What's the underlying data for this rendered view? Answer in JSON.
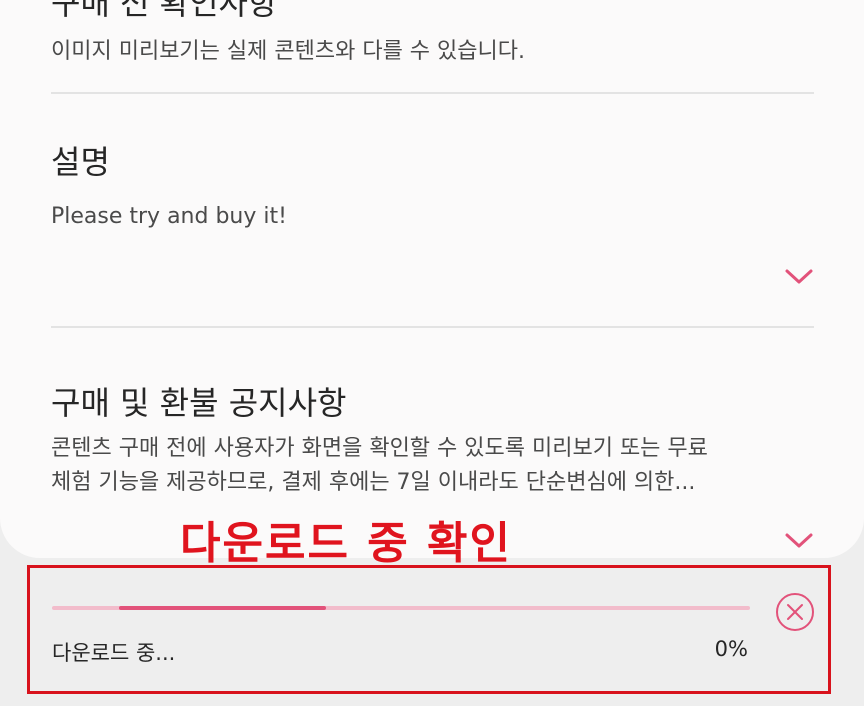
{
  "purchase_notes": {
    "title": "구매 전 확인사항",
    "body": "이미지 미리보기는 실제 콘텐츠와 다를 수 있습니다."
  },
  "description": {
    "title": "설명",
    "body": "Please try and buy it!"
  },
  "refund_policy": {
    "title": "구매 및 환불 공지사항",
    "body_line1": "콘텐츠 구매 전에 사용자가 화면을 확인할 수 있도록 미리보기 또는 무료",
    "body_line2": "체험 기능을 제공하므로, 결제 후에는 7일 이내라도 단순변심에 의한..."
  },
  "annotation": {
    "text": "다운로드 중 확인"
  },
  "download": {
    "status_label": "다운로드 중...",
    "percent_label": "0%",
    "progress_fraction": 0.0
  },
  "colors": {
    "accent": "#e2527a",
    "track": "#f2bccb",
    "annotation_red": "#e0141e"
  },
  "icons": {
    "expand": "chevron-down-icon",
    "cancel": "close-circle-icon"
  }
}
